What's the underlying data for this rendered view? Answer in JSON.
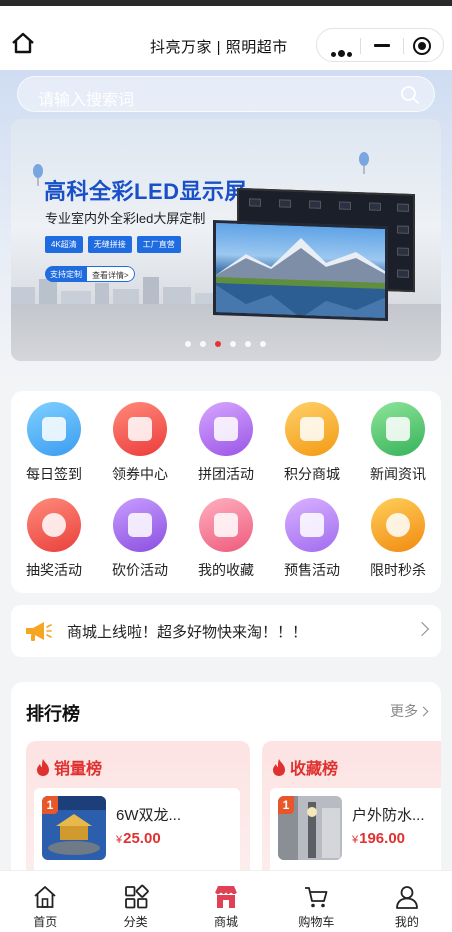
{
  "nav": {
    "title": "抖亮万家 | 照明超市"
  },
  "search": {
    "placeholder": "请输入搜索词"
  },
  "banner": {
    "title": "高科全彩LED显示屏",
    "subtitle": "专业室内外全彩led大屏定制",
    "tags": [
      "4K超清",
      "无缝拼接",
      "工厂直营"
    ],
    "cta_left": "支持定制",
    "cta_right": "查看详情>",
    "slide_count": 6,
    "active_slide": 3
  },
  "functions": [
    {
      "label": "每日签到",
      "icon": "calendar-check-icon",
      "color": "#4aaef0"
    },
    {
      "label": "领券中心",
      "icon": "coupon-icon",
      "color": "#f0584d"
    },
    {
      "label": "拼团活动",
      "icon": "group-buy-bag-icon",
      "color": "#b173e8"
    },
    {
      "label": "积分商城",
      "icon": "points-wallet-icon",
      "color": "#f5a623"
    },
    {
      "label": "新闻资讯",
      "icon": "news-icon",
      "color": "#4cc26a"
    },
    {
      "label": "抽奖活动",
      "icon": "lucky-wheel-icon",
      "color": "#f15b4e"
    },
    {
      "label": "砍价活动",
      "icon": "bargain-knife-icon",
      "color": "#a469e8"
    },
    {
      "label": "我的收藏",
      "icon": "favorites-star-icon",
      "color": "#f46e8a"
    },
    {
      "label": "预售活动",
      "icon": "presale-clock-icon",
      "color": "#b67cf0"
    },
    {
      "label": "限时秒杀",
      "icon": "flash-sale-alarm-icon",
      "color": "#f7a21e"
    }
  ],
  "notice": {
    "text": "商城上线啦！超多好物快来淘！！！",
    "icon": "megaphone-icon"
  },
  "ranking": {
    "title": "排行榜",
    "more": "更多",
    "lists": [
      {
        "title": "销量榜",
        "rank": "1",
        "name": "6W双龙...",
        "price": "25.00",
        "currency": "¥"
      },
      {
        "title": "收藏榜",
        "rank": "1",
        "name": "户外防水...",
        "price": "196.00",
        "currency": "¥"
      }
    ]
  },
  "tabbar": [
    {
      "label": "首页",
      "icon": "home-icon"
    },
    {
      "label": "分类",
      "icon": "category-grid-icon"
    },
    {
      "label": "商城",
      "icon": "shop-store-icon"
    },
    {
      "label": "购物车",
      "icon": "cart-icon"
    },
    {
      "label": "我的",
      "icon": "user-icon"
    }
  ],
  "colors": {
    "accent": "#e03131",
    "banner_blue": "#1950c8"
  }
}
